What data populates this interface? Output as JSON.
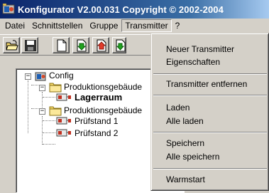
{
  "window": {
    "title": "Konfigurator  V2.00.031 Copyright © 2002-2004"
  },
  "menubar": {
    "items": [
      {
        "label": "Datei"
      },
      {
        "label": "Schnittstellen"
      },
      {
        "label": "Gruppe"
      },
      {
        "label": "Transmitter"
      },
      {
        "label": "?"
      }
    ]
  },
  "toolbar": {
    "buttons": [
      "open-folder-icon",
      "save-icon",
      "new-document-icon",
      "green-arrow-down-icon",
      "red-arrow-up-icon",
      "green-arrow-icon"
    ]
  },
  "tree": {
    "nodes": [
      {
        "label": "Config"
      },
      {
        "label": "Produktionsgebäude"
      },
      {
        "label": "Lagerraum"
      },
      {
        "label": "Produktionsgebäude"
      },
      {
        "label": "Prüfstand 1"
      },
      {
        "label": "Prüfstand 2"
      }
    ]
  },
  "dropdown": {
    "items": [
      {
        "label": "Neuer Transmitter"
      },
      {
        "label": "Eigenschaften"
      },
      {
        "label": "Transmitter entfernen"
      },
      {
        "label": "Laden"
      },
      {
        "label": "Alle laden"
      },
      {
        "label": "Speichern"
      },
      {
        "label": "Alle speichern"
      },
      {
        "label": "Warmstart"
      }
    ]
  },
  "colors": {
    "titlebar_start": "#0a246a",
    "titlebar_end": "#a6caf0",
    "face": "#d4d0c8",
    "folder": "#f5d86a"
  }
}
